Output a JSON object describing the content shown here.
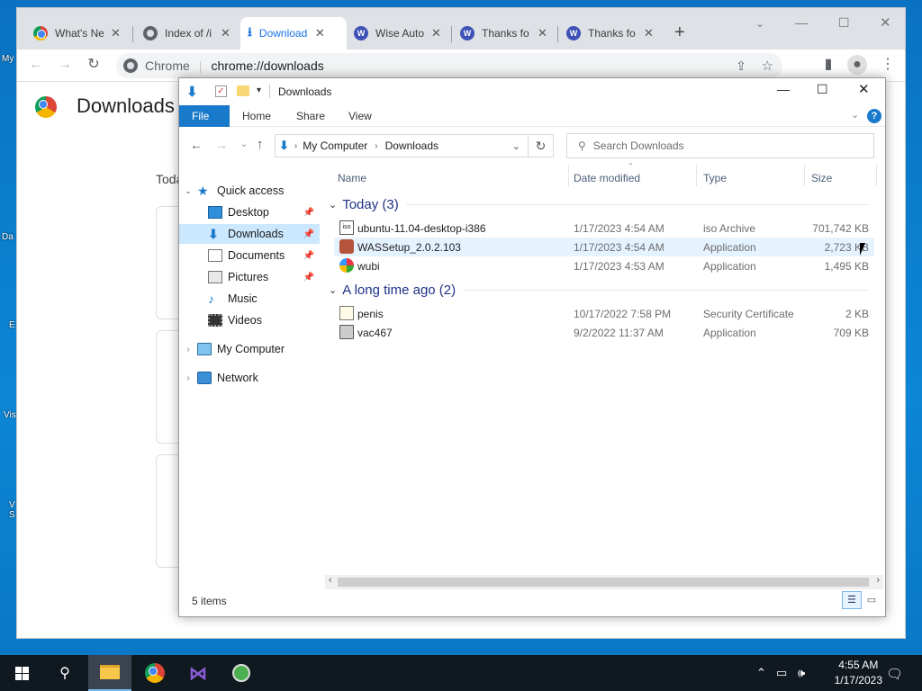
{
  "desktop": {
    "icon_labels": [
      "My",
      "Da",
      "E",
      "Vis",
      "V S"
    ]
  },
  "chrome": {
    "tabs": [
      {
        "title": "What's New",
        "icon": "chrome-icon"
      },
      {
        "title": "Index of /i",
        "icon": "globe-icon"
      },
      {
        "title": "Downloads",
        "icon": "download-icon",
        "active": true
      },
      {
        "title": "Wise Auto",
        "icon": "wise-icon"
      },
      {
        "title": "Thanks fo",
        "icon": "wise-icon"
      },
      {
        "title": "Thanks fo",
        "icon": "wise-icon"
      }
    ],
    "omnibox_site": "Chrome",
    "omnibox_url": "chrome://downloads",
    "page_title": "Downloads",
    "today_label": "Toda"
  },
  "explorer": {
    "window_title": "Downloads",
    "ribbon_tabs": [
      "File",
      "Home",
      "Share",
      "View"
    ],
    "breadcrumb": [
      "My Computer",
      "Downloads"
    ],
    "search_placeholder": "Search Downloads",
    "nav": {
      "quick_access": "Quick access",
      "items": [
        "Desktop",
        "Downloads",
        "Documents",
        "Pictures",
        "Music",
        "Videos"
      ],
      "my_computer": "My Computer",
      "network": "Network"
    },
    "columns": [
      "Name",
      "Date modified",
      "Type",
      "Size"
    ],
    "groups": [
      {
        "label": "Today (3)",
        "files": [
          {
            "name": "ubuntu-11.04-desktop-i386",
            "date": "1/17/2023 4:54 AM",
            "type": "iso Archive",
            "size": "701,742 KB"
          },
          {
            "name": "WASSetup_2.0.2.103",
            "date": "1/17/2023 4:54 AM",
            "type": "Application",
            "size": "2,723 KB"
          },
          {
            "name": "wubi",
            "date": "1/17/2023 4:53 AM",
            "type": "Application",
            "size": "1,495 KB"
          }
        ]
      },
      {
        "label": "A long time ago (2)",
        "files": [
          {
            "name": "penis",
            "date": "10/17/2022 7:58 PM",
            "type": "Security Certificate",
            "size": "2 KB"
          },
          {
            "name": "vac467",
            "date": "9/2/2022 11:37 AM",
            "type": "Application",
            "size": "709 KB"
          }
        ]
      }
    ],
    "status": "5 items"
  },
  "taskbar": {
    "time": "4:55 AM",
    "date": "1/17/2023"
  },
  "colors": {
    "accent": "#1979ca",
    "selection": "#cce8ff",
    "group_header": "#1e3287",
    "taskbar": "#101820"
  }
}
